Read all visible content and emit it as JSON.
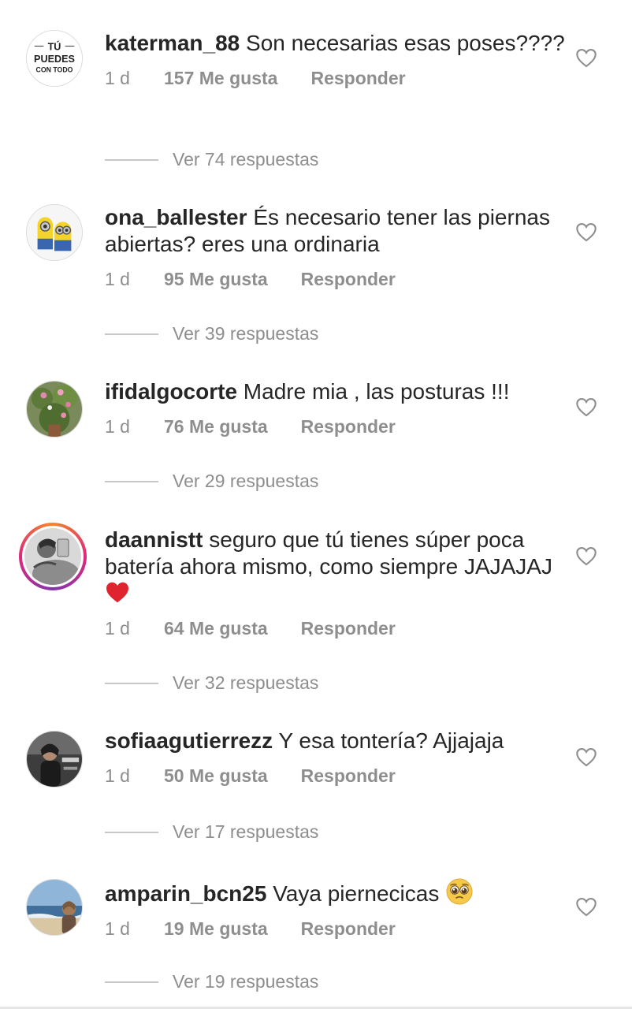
{
  "comments": [
    {
      "username": "katerman_88",
      "text": "Son necesarias esas poses????",
      "time": "1 d",
      "likes": "157 Me gusta",
      "reply": "Responder",
      "view_replies": "Ver 74 respuestas",
      "avatar": "tu-puedes-con-todo-logo",
      "avatar_text": "TÚ PUEDES CON TODO"
    },
    {
      "username": "ona_ballester",
      "text": "És necesario tener las piernas abiertas? eres una ordinaria",
      "time": "1 d",
      "likes": "95 Me gusta",
      "reply": "Responder",
      "view_replies": "Ver 39 respuestas",
      "avatar": "minions-avatar"
    },
    {
      "username": "ifidalgocorte",
      "text": "Madre mia , las posturas !!!",
      "time": "1 d",
      "likes": "76 Me gusta",
      "reply": "Responder",
      "view_replies": "Ver 29 respuestas",
      "avatar": "flowers-avatar"
    },
    {
      "username": "daannistt",
      "text": "seguro que tú tienes súper poca batería ahora mismo, como siempre JAJAJAJ",
      "time": "1 d",
      "likes": "64 Me gusta",
      "reply": "Responder",
      "view_replies": "Ver 32 respuestas",
      "avatar": "selfie-avatar",
      "emoji": "red-heart"
    },
    {
      "username": "sofiaagutierrezz",
      "text": "Y esa tontería? Ajjajaja",
      "time": "1 d",
      "likes": "50 Me gusta",
      "reply": "Responder",
      "view_replies": "Ver 17 respuestas",
      "avatar": "person-avatar"
    },
    {
      "username": "amparin_bcn25",
      "text": "Vaya piernecicas",
      "time": "1 d",
      "likes": "19 Me gusta",
      "reply": "Responder",
      "view_replies": "Ver 19 respuestas",
      "avatar": "beach-avatar",
      "emoji": "pleading-face"
    }
  ],
  "colors": {
    "text": "#262626",
    "meta": "#8e8e8e",
    "heart_outline": "#8e8e8e",
    "emoji_heart": "#e0242f"
  }
}
